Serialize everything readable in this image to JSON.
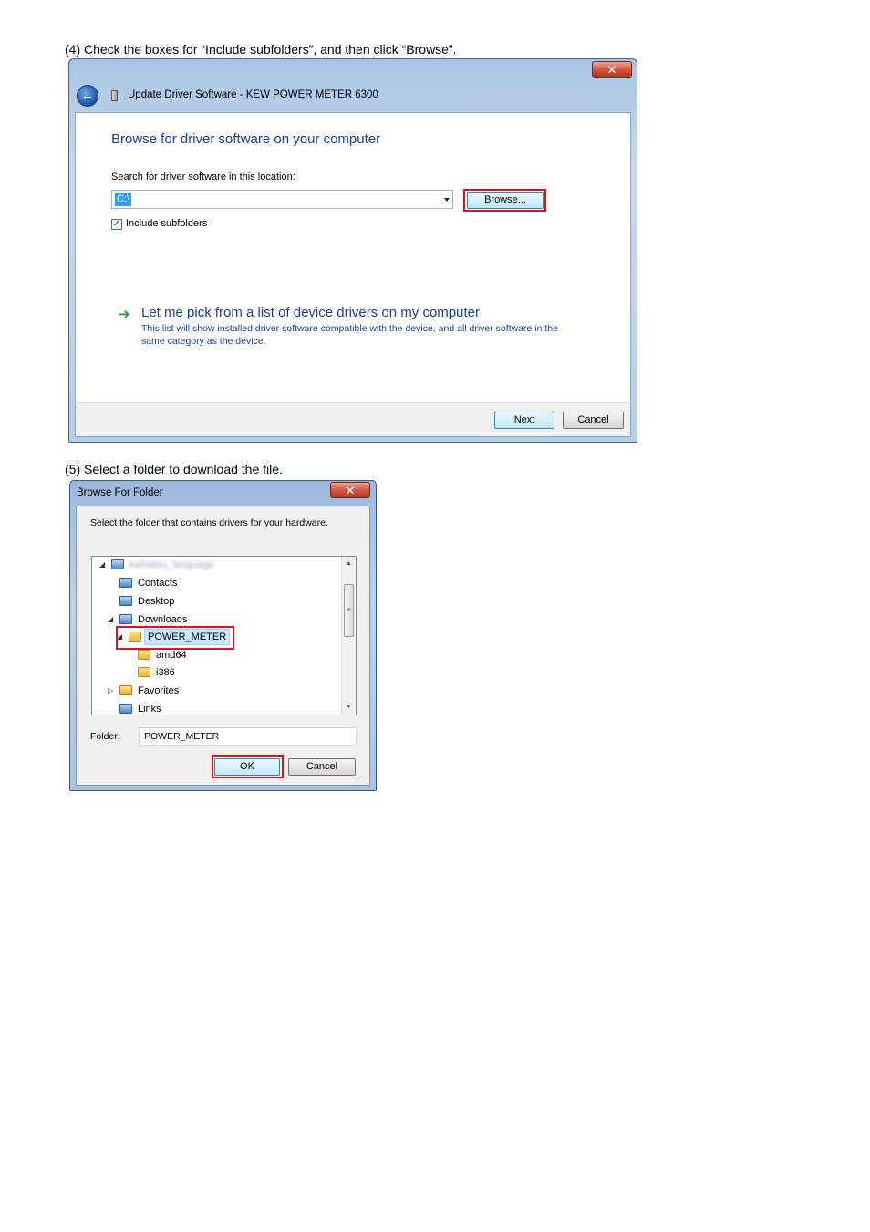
{
  "step4": {
    "caption": "(4)  Check the boxes for  “Include subfolders”, and then click “Browse”."
  },
  "update_dialog": {
    "title": "Update Driver Software - KEW POWER METER 6300",
    "close_glyph": "✕",
    "back_glyph": "←",
    "heading": "Browse for driver software on your computer",
    "search_label": "Search for driver software in this location:",
    "path_value": "C:\\",
    "browse_label": "Browse...",
    "include_subfolders_label": "Include subfolders",
    "include_subfolders_checked": true,
    "check_glyph": "✓",
    "arrow_glyph": "➔",
    "pick_link_title": "Let me pick from a list of device drivers on my computer",
    "pick_link_desc": "This list will show installed driver software compatible with the device, and all driver software in the same category as the device.",
    "next_label": "Next",
    "cancel_label": "Cancel"
  },
  "step5": {
    "caption": "(5)  Select a folder to download the file."
  },
  "browse_dialog": {
    "title": "Browse For Folder",
    "close_glyph": "✕",
    "instruction": "Select the folder that contains drivers for your hardware.",
    "tree": {
      "root_label": "kaihatsu_language",
      "items": [
        {
          "label": "Contacts",
          "icon": "contacts-folder-icon"
        },
        {
          "label": "Desktop",
          "icon": "desktop-folder-icon"
        },
        {
          "label": "Downloads",
          "icon": "downloads-folder-icon"
        },
        {
          "label": "POWER_METER",
          "icon": "folder-icon"
        },
        {
          "label": "amd64",
          "icon": "folder-icon"
        },
        {
          "label": "i386",
          "icon": "folder-icon"
        },
        {
          "label": "Favorites",
          "icon": "favorites-folder-icon"
        },
        {
          "label": "Links",
          "icon": "links-folder-icon"
        }
      ],
      "selected": "POWER_METER"
    },
    "folder_label": "Folder:",
    "folder_value": "POWER_METER",
    "ok_label": "OK",
    "cancel_label": "Cancel"
  },
  "colors": {
    "highlight_red": "#d7141a",
    "link_blue": "#1e3e94"
  }
}
